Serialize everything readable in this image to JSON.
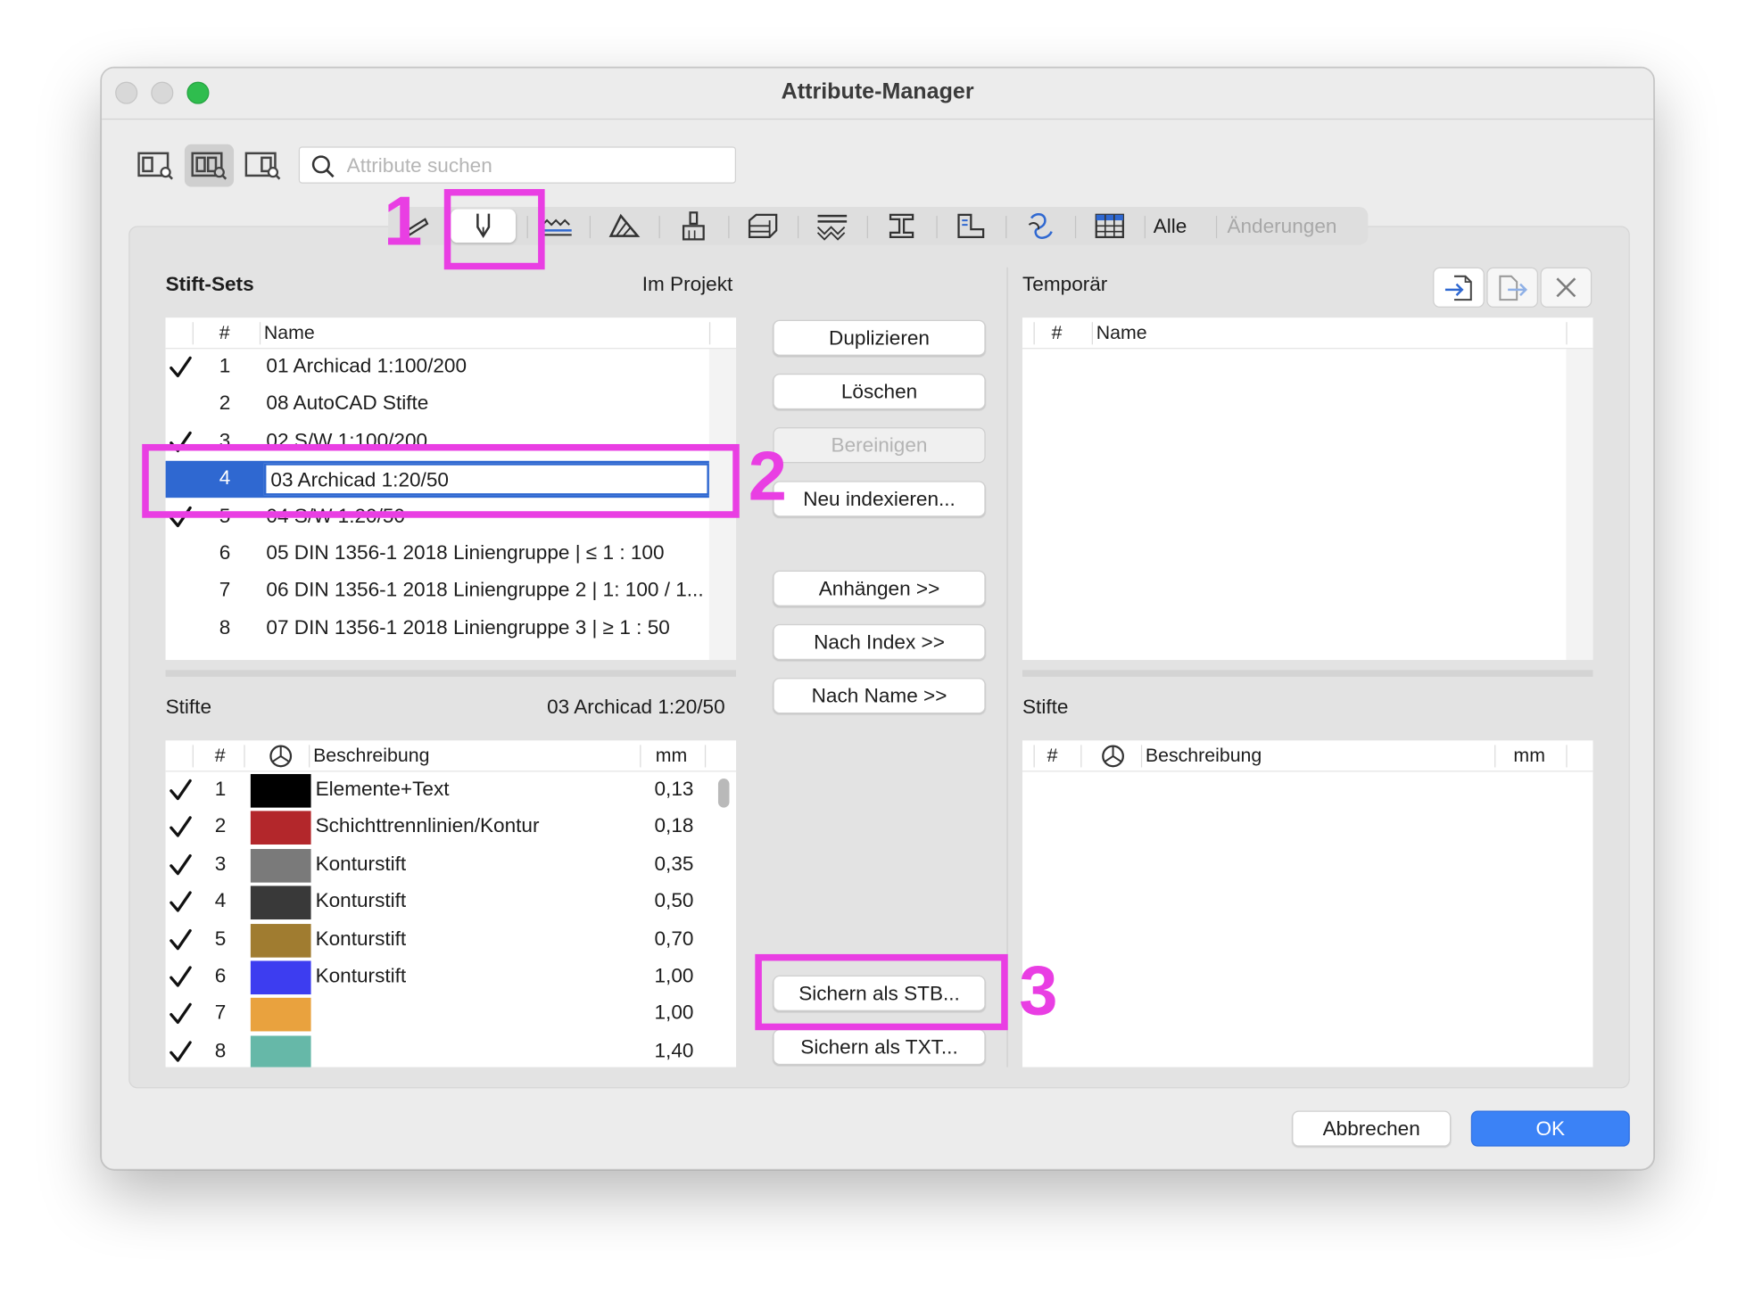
{
  "window": {
    "title": "Attribute-Manager"
  },
  "search": {
    "placeholder": "Attribute suchen"
  },
  "view_buttons": [
    "view-left-icon",
    "view-both-icon",
    "view-right-icon"
  ],
  "tabs": {
    "icons": [
      "line-type-icon",
      "pen-icon",
      "line-pattern-icon",
      "fill-icon",
      "surface-brush-icon",
      "composite-icon",
      "profile-hatch-icon",
      "profile-icon",
      "zone-category-icon",
      "mep-icon",
      "table-icon"
    ],
    "selected": "pen-icon",
    "all_label": "Alle",
    "changes_label": "Änderungen"
  },
  "left": {
    "sets_title": "Stift-Sets",
    "sets_scope": "Im Projekt",
    "sets_columns": {
      "num": "#",
      "name": "Name"
    },
    "sets": [
      {
        "num": "1",
        "name": "01 Archicad 1:100/200",
        "checked": true
      },
      {
        "num": "2",
        "name": "08 AutoCAD Stifte",
        "checked": false
      },
      {
        "num": "3",
        "name": "02 S/W 1:100/200",
        "checked": true
      },
      {
        "num": "4",
        "name": "03 Archicad 1:20/50",
        "checked": false,
        "selected": true
      },
      {
        "num": "5",
        "name": "04 S/W 1:20/50",
        "checked": true
      },
      {
        "num": "6",
        "name": "05 DIN 1356-1 2018 Liniengruppe | ≤ 1 : 100",
        "checked": false
      },
      {
        "num": "7",
        "name": "06 DIN 1356-1 2018 Liniengruppe 2 | 1: 100 / 1...",
        "checked": false
      },
      {
        "num": "8",
        "name": "07 DIN 1356-1 2018 Liniengruppe 3 | ≥ 1 : 50",
        "checked": false
      }
    ],
    "pens_title": "Stifte",
    "pens_set_name": "03 Archicad 1:20/50",
    "pens_columns": {
      "num": "#",
      "color_icon": "color-wheel-icon",
      "desc": "Beschreibung",
      "mm": "mm"
    },
    "pens": [
      {
        "num": "1",
        "color": "#000000",
        "desc": "Elemente+Text",
        "mm": "0,13",
        "checked": true
      },
      {
        "num": "2",
        "color": "#b3272b",
        "desc": "Schichttrennlinien/Kontur",
        "mm": "0,18",
        "checked": true
      },
      {
        "num": "3",
        "color": "#7a7a7a",
        "desc": "Konturstift",
        "mm": "0,35",
        "checked": true
      },
      {
        "num": "4",
        "color": "#393939",
        "desc": "Konturstift",
        "mm": "0,50",
        "checked": true
      },
      {
        "num": "5",
        "color": "#a07c30",
        "desc": "Konturstift",
        "mm": "0,70",
        "checked": true
      },
      {
        "num": "6",
        "color": "#3d3df0",
        "desc": "Konturstift",
        "mm": "1,00",
        "checked": true
      },
      {
        "num": "7",
        "color": "#e9a23e",
        "desc": "",
        "mm": "1,00",
        "checked": true
      },
      {
        "num": "8",
        "color": "#66b8a8",
        "desc": "",
        "mm": "1,40",
        "checked": true
      }
    ]
  },
  "middle": {
    "duplicate": "Duplizieren",
    "delete": "Löschen",
    "purge": "Bereinigen",
    "reindex": "Neu indexieren...",
    "append": "Anhängen >>",
    "by_index": "Nach Index >>",
    "by_name": "Nach Name >>",
    "save_stb": "Sichern als STB...",
    "save_txt": "Sichern als TXT..."
  },
  "right": {
    "title": "Temporär",
    "columns": {
      "num": "#",
      "name": "Name"
    },
    "pens_title": "Stifte",
    "pens_columns": {
      "num": "#",
      "color_icon": "color-wheel-icon",
      "desc": "Beschreibung",
      "mm": "mm"
    },
    "actions": [
      "import-icon",
      "export-icon",
      "close-icon"
    ]
  },
  "footer": {
    "cancel": "Abbrechen",
    "ok": "OK"
  },
  "annotations": [
    "1",
    "2",
    "3"
  ],
  "colors": {
    "accent": "#3b82f6",
    "selection": "#2f68d1",
    "annotation": "#e93ee3"
  }
}
